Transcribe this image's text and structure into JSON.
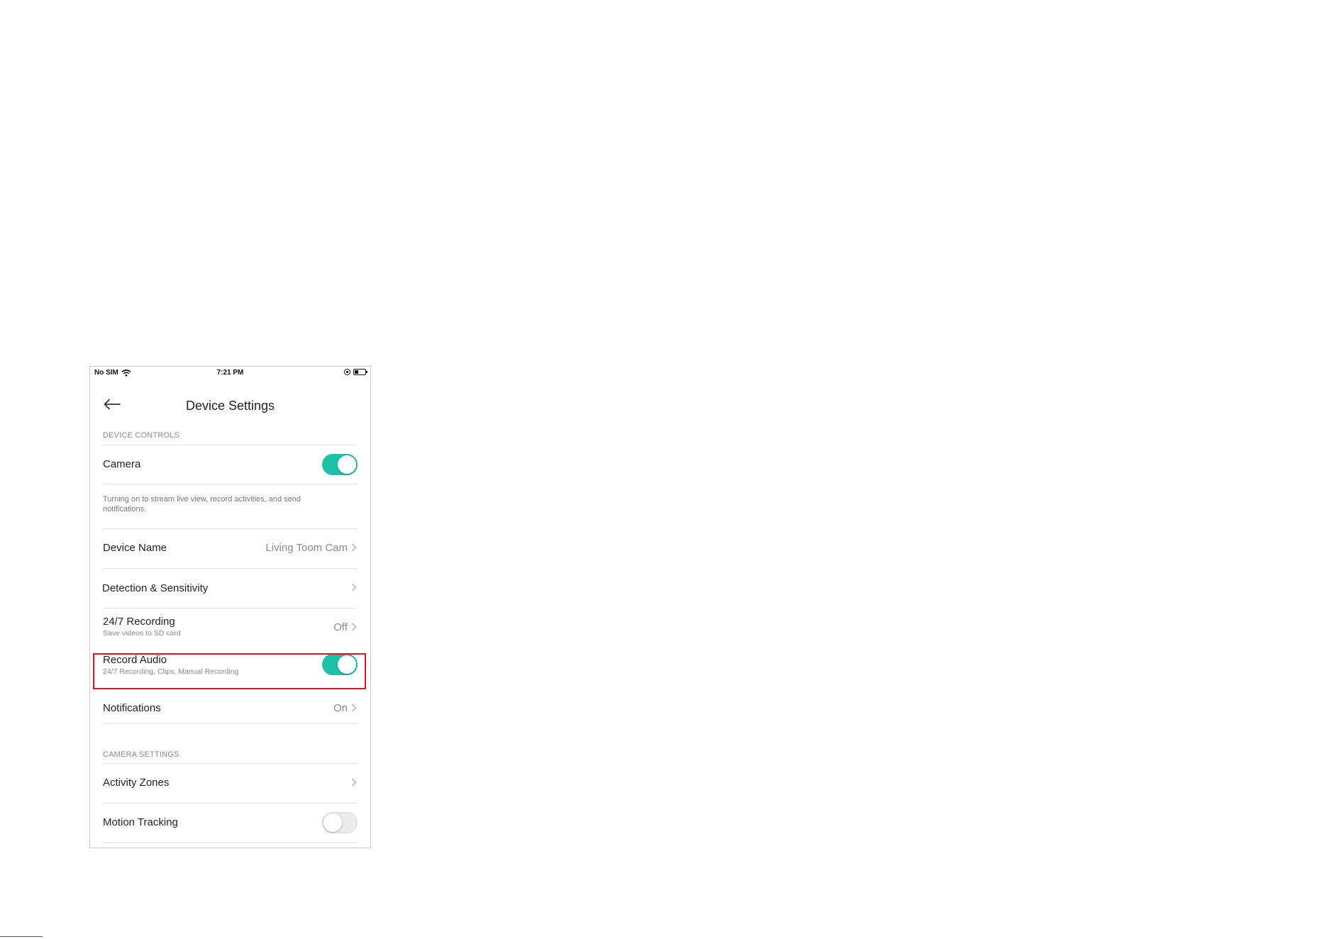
{
  "status_bar": {
    "carrier": "No SIM",
    "time": "7:21 PM"
  },
  "header": {
    "title": "Device Settings",
    "back_icon": "arrow-left-icon"
  },
  "sections": {
    "device_controls": "DEVICE CONTROLS",
    "camera_settings": "CAMERA SETTINGS"
  },
  "rows": {
    "camera": {
      "label": "Camera",
      "toggle": true
    },
    "camera_description": "Turning on to stream live view, record activities, and send notifications.",
    "device_name": {
      "label": "Device Name",
      "value": "Living Toom Cam"
    },
    "detection": {
      "label": "Detection & Sensitivity"
    },
    "recording": {
      "label": "24/7 Recording",
      "sub": "Save videos to SD card",
      "value": "Off"
    },
    "record_audio": {
      "label": "Record Audio",
      "sub": "24/7 Recording, Clips, Manual Recording",
      "toggle": true
    },
    "notifications": {
      "label": "Notifications",
      "value": "On"
    },
    "activity_zones": {
      "label": "Activity Zones"
    },
    "motion_tracking": {
      "label": "Motion Tracking",
      "toggle": false
    }
  },
  "colors": {
    "toggle_on": "#1cc2a7",
    "highlight": "#e0141b"
  }
}
